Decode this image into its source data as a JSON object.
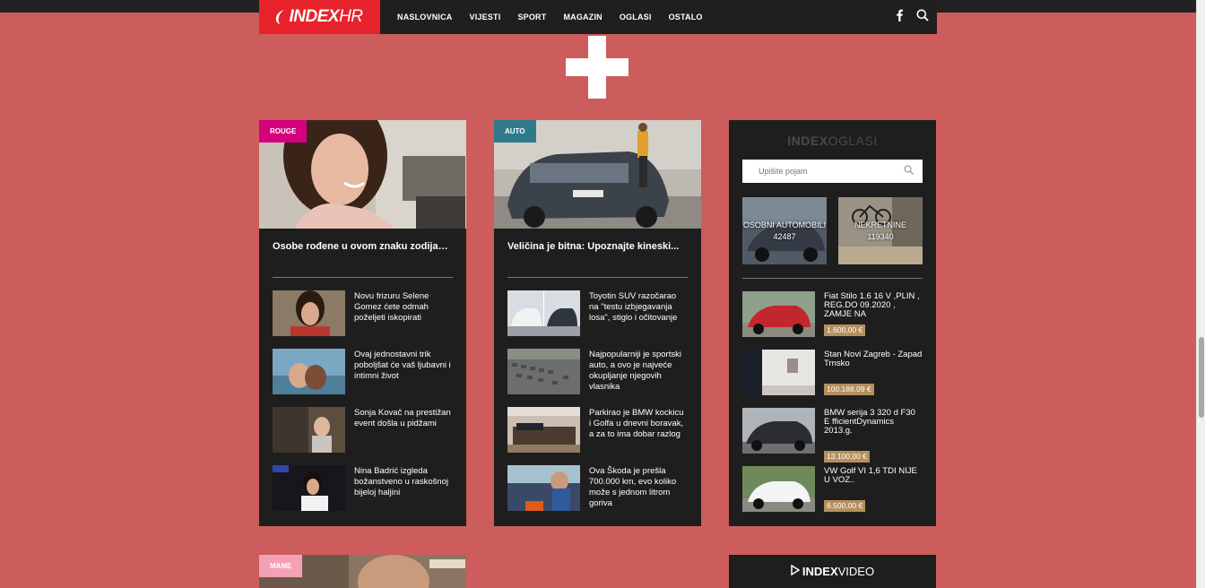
{
  "nav": {
    "logo_bold": "INDEX",
    "logo_light": "HR",
    "items": [
      "NASLOVNICA",
      "VIJESTI",
      "SPORT",
      "MAGAZIN",
      "OGLASI",
      "OSTALO"
    ],
    "icons": [
      "facebook-icon",
      "search-icon"
    ]
  },
  "rouge": {
    "tag": "ROUGE",
    "tag_color": "#d6007e",
    "headline": "Osobe rođene u ovom znaku zodijaka...",
    "items": [
      {
        "text": "Novu frizuru Selene Gomez ćete odmah poželjeti iskopirati"
      },
      {
        "text": "Ovaj jednostavni trik poboljšat će vaš ljubavni i intimni život"
      },
      {
        "text": "Sonja Kovač na prestižan event došla u pidžami"
      },
      {
        "text": "Nina Badrić izgleda božanstveno u raskošnoj bijeloj haljini"
      }
    ]
  },
  "auto": {
    "tag": "AUTO",
    "tag_color": "#2e7a8a",
    "headline": "Veličina je bitna: Upoznajte kineski...",
    "items": [
      {
        "text": "Toyotin SUV razočarao na \"testu izbjegavanja losa\", stiglo i očitovanje"
      },
      {
        "text": "Najpopularniji je sportski auto, a ovo je najveće okupljanje njegovih vlasnika"
      },
      {
        "text": "Parkirao je BMW kockicu i Golfa u dnevni boravak, a za to ima dobar razlog"
      },
      {
        "text": "Ova Škoda je prešla 700.000 km, evo koliko može s jednom litrom goriva"
      }
    ]
  },
  "oglasi": {
    "logo_bold": "INDEX",
    "logo_light": "OGLASI",
    "search_placeholder": "Upišite pojam",
    "categories": [
      {
        "label": "OSOBNI AUTOMOBILI",
        "count": "42487"
      },
      {
        "label": "NEKRETNINE",
        "count": "119340"
      }
    ],
    "items": [
      {
        "title": "Fiat Stilo 1.6 16 V ,PLIN , REG.DO 09.2020 , ZAMJE NA",
        "price": "1.600,00 €"
      },
      {
        "title": "Stan Novi Zagreb - Zapad Trnsko",
        "price": "100.188,09 €"
      },
      {
        "title": "BMW serija 3 320 d F30 E fficientDynamics 2013.g.",
        "price": "13.100,00 €"
      },
      {
        "title": "VW Golf VI 1,6 TDI NIJE U VOZ..",
        "price": "6.500,00 €"
      }
    ],
    "price_color": "#b58f5e"
  },
  "mame": {
    "tag": "MAME",
    "tag_color": "#f4a0b5"
  },
  "video": {
    "logo_bold": "INDEX",
    "logo_light": "VIDEO"
  }
}
